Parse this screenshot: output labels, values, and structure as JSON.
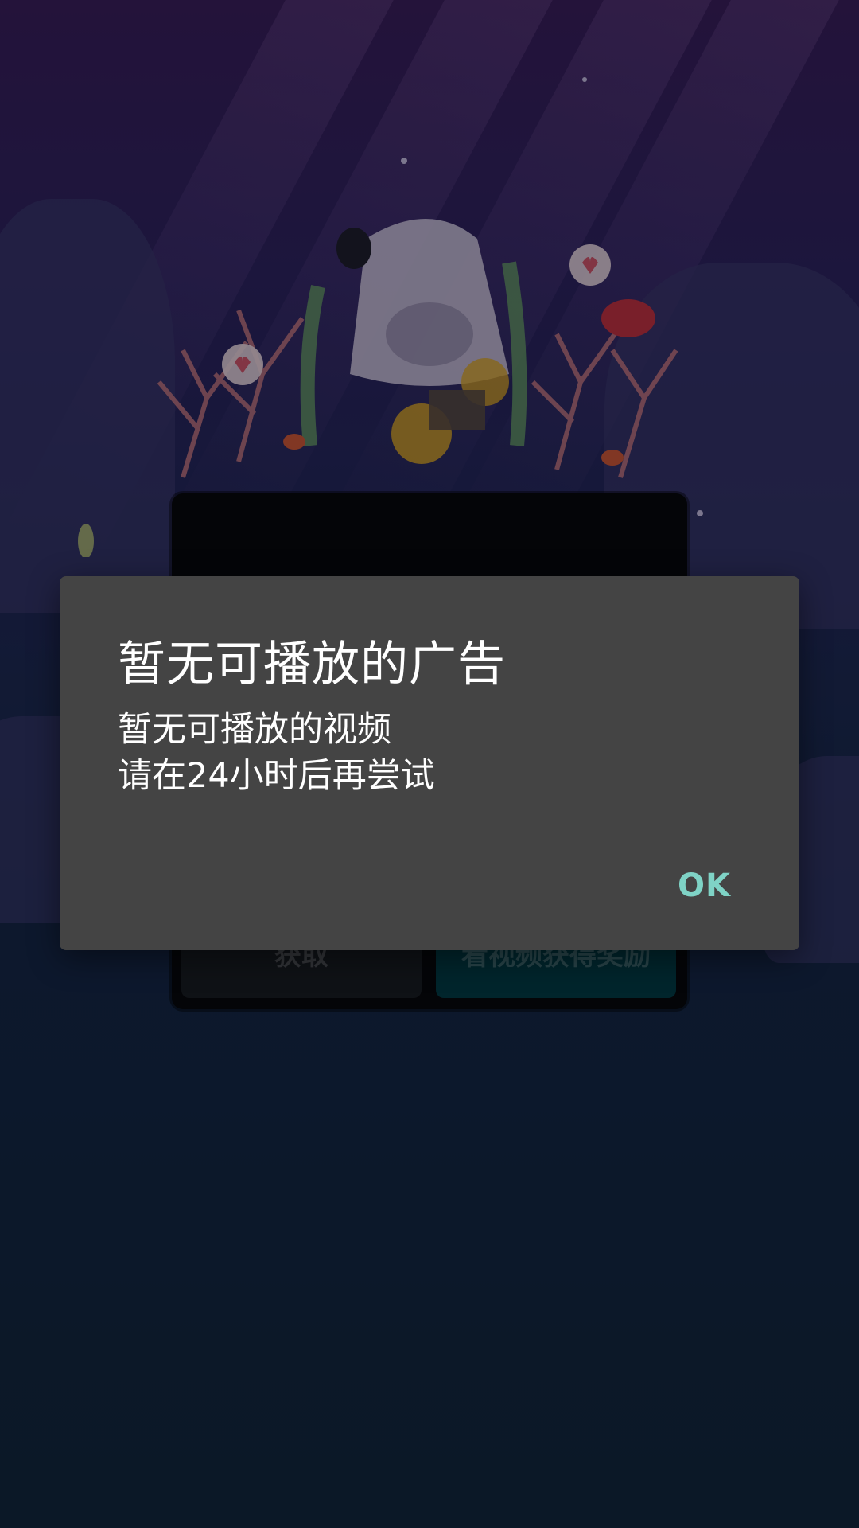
{
  "background": {
    "panel_left_label": "获取",
    "panel_right_label": "看视频获得奖励",
    "colors": {
      "top": "#3a1f5e",
      "bottom": "#13283f",
      "panel": "#08090d",
      "panel_right_button": "#033c47"
    }
  },
  "dialog": {
    "title": "暂无可播放的广告",
    "message_line1": "暂无可播放的视频",
    "message_line2": "请在24小时后再尝试",
    "ok_label": "OK",
    "colors": {
      "background": "#444444",
      "text": "#ffffff",
      "accent": "#7fd3c6"
    }
  }
}
